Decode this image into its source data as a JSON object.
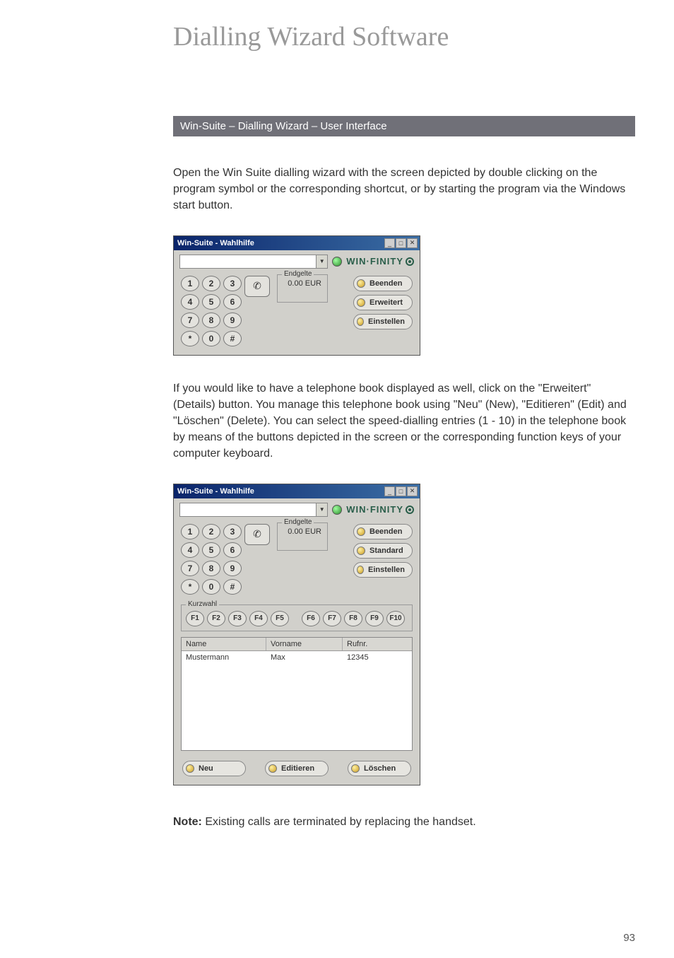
{
  "page_title": "Dialling Wizard Software",
  "section_header": "Win-Suite – Dialling Wizard – User Interface",
  "paragraph1": "Open the Win Suite dialling wizard with the screen depicted by double clicking on the program symbol or the corresponding shortcut, or by starting the program via the Windows start button.",
  "paragraph2": "If you would like to have a telephone book displayed as well, click on the \"Erweitert\" (Details) button. You manage this telephone book using \"Neu\" (New), \"Editieren\" (Edit) and \"Löschen\" (Delete). You can select the speed-dialling entries (1 - 10) in the telephone book by means of the buttons depicted in the screen or the corresponding function keys of your computer keyboard.",
  "note_label": "Note:",
  "note_text": " Existing calls are terminated by replacing the handset.",
  "page_number": "93",
  "app": {
    "title": "Win-Suite - Wahlhilfe",
    "brand": "WIN·FINITY",
    "endgelte_label": "Endgelte",
    "endgelte_value": "0.00 EUR",
    "kurzwahl_label": "Kurzwahl",
    "keys": [
      "1",
      "2",
      "3",
      "4",
      "5",
      "6",
      "7",
      "8",
      "9",
      "*",
      "0",
      "#"
    ],
    "fkeys": [
      "F1",
      "F2",
      "F3",
      "F4",
      "F5",
      "F6",
      "F7",
      "F8",
      "F9",
      "F10"
    ],
    "buttons": {
      "beenden": "Beenden",
      "erweitert": "Erweitert",
      "standard": "Standard",
      "einstellen": "Einstellen",
      "neu": "Neu",
      "editieren": "Editieren",
      "loeschen": "Löschen"
    },
    "list": {
      "col_name": "Name",
      "col_vorname": "Vorname",
      "col_rufnr": "Rufnr.",
      "rows": [
        {
          "name": "Mustermann",
          "vorname": "Max",
          "rufnr": "12345"
        }
      ]
    }
  }
}
